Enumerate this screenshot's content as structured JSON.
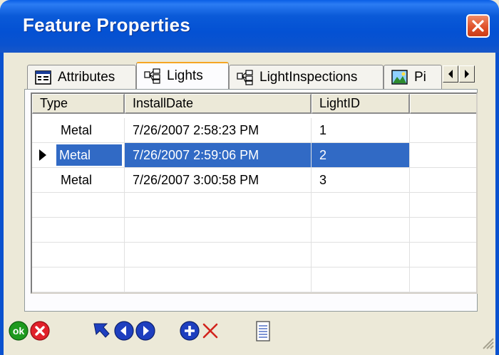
{
  "window": {
    "title": "Feature Properties"
  },
  "tabs": [
    {
      "label": "Attributes",
      "icon": "table-icon",
      "active": false
    },
    {
      "label": "Lights",
      "icon": "relationship-icon",
      "active": true
    },
    {
      "label": "LightInspections",
      "icon": "relationship-icon",
      "active": false
    },
    {
      "label": "Pi",
      "icon": "picture-icon",
      "active": false
    }
  ],
  "grid": {
    "columns": [
      "Type",
      "InstallDate",
      "LightID",
      ""
    ],
    "rows": [
      {
        "type": "Metal",
        "install_date": "7/26/2007 2:58:23 PM",
        "light_id": "1",
        "selected": false
      },
      {
        "type": "Metal",
        "install_date": "7/26/2007 2:59:06 PM",
        "light_id": "2",
        "selected": true
      },
      {
        "type": "Metal",
        "install_date": "7/26/2007 3:00:58 PM",
        "light_id": "3",
        "selected": false
      }
    ]
  },
  "toolbar": {
    "ok_label": "ok",
    "icons": [
      "ok-icon",
      "cancel-icon",
      "select-arrow-icon",
      "previous-icon",
      "next-icon",
      "add-icon",
      "delete-icon",
      "document-icon"
    ]
  },
  "colors": {
    "title_bar": "#0a52cf",
    "selection": "#316ac5",
    "active_tab_accent": "#f5a623",
    "close_button": "#e0522b"
  }
}
